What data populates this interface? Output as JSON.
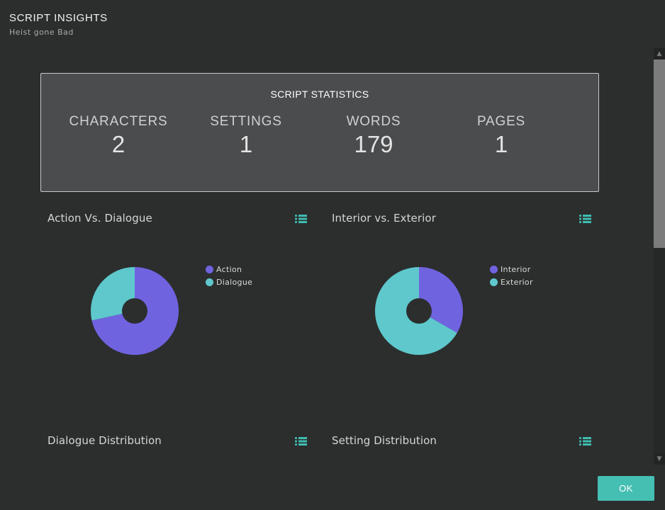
{
  "header": {
    "title": "SCRIPT INSIGHTS",
    "subtitle": "Heist gone Bad"
  },
  "stats": {
    "title": "SCRIPT STATISTICS",
    "items": [
      {
        "label": "CHARACTERS",
        "value": "2"
      },
      {
        "label": "SETTINGS",
        "value": "1"
      },
      {
        "label": "WORDS",
        "value": "179"
      },
      {
        "label": "PAGES",
        "value": "1"
      }
    ]
  },
  "panels": [
    {
      "title": "Action Vs. Dialogue",
      "icon": "list-icon"
    },
    {
      "title": "Interior vs. Exterior",
      "icon": "list-icon"
    },
    {
      "title": "Dialogue Distribution",
      "icon": "list-icon"
    },
    {
      "title": "Setting Distribution",
      "icon": "list-icon"
    }
  ],
  "colors": {
    "accent": "#46bfb3",
    "purple": "#7063e0",
    "teal": "#5ec8cc",
    "icon": "#3fbdb1"
  },
  "chart_data": [
    {
      "type": "pie",
      "title": "Action Vs. Dialogue",
      "categories": [
        "Action",
        "Dialogue"
      ],
      "values": [
        71.5,
        28.5
      ],
      "colors": [
        "#7063e0",
        "#5ec8cc"
      ],
      "legend": "right"
    },
    {
      "type": "pie",
      "title": "Interior vs. Exterior",
      "categories": [
        "Interior",
        "Exterior"
      ],
      "values": [
        33.3,
        66.7
      ],
      "colors": [
        "#7063e0",
        "#5ec8cc"
      ],
      "legend": "right"
    }
  ],
  "footer": {
    "ok_label": "OK"
  }
}
